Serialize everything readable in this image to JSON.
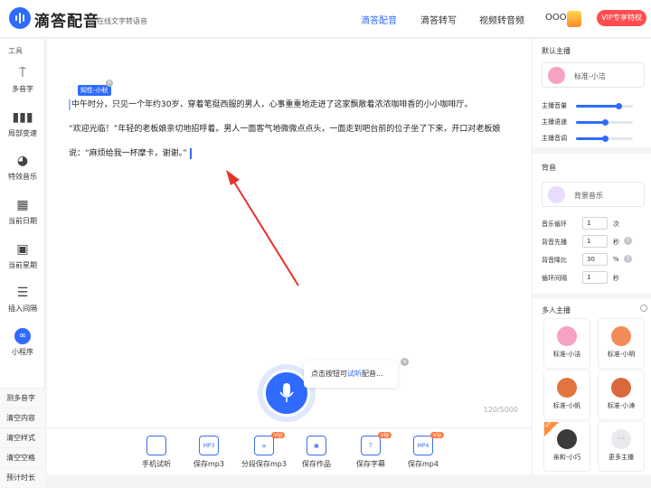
{
  "header": {
    "app_title": "滴答配音",
    "app_subtitle": "在线文字转语音",
    "nav": [
      {
        "label": "滴答配音",
        "active": true
      },
      {
        "label": "滴答转写",
        "active": false
      },
      {
        "label": "视频转音频",
        "active": false
      }
    ],
    "user_name": "OOO",
    "vip_button": "VIP专享特权"
  },
  "sidebar": {
    "title": "工具",
    "tools": [
      {
        "label": "多音字",
        "icon": "polyphone-icon"
      },
      {
        "label": "局部变速",
        "icon": "speed-icon"
      },
      {
        "label": "特效音乐",
        "icon": "music-disc-icon"
      },
      {
        "label": "当前日期",
        "icon": "calendar-icon"
      },
      {
        "label": "当前星期",
        "icon": "calendar-week-icon"
      },
      {
        "label": "插入间隔",
        "icon": "interval-icon"
      },
      {
        "label": "小程序",
        "icon": "mini-program-icon"
      }
    ],
    "links": [
      "测多音字",
      "清空内容",
      "清空样式",
      "清空空格",
      "预计时长"
    ]
  },
  "editor": {
    "voice_tag": "知性-小秋",
    "paragraph1": "中午时分，只见一个年约30岁，穿着笔挺西服的男人，心事重重地走进了这家飘散着浓浓咖啡香的小小咖啡厅。",
    "paragraph2": "“欢迎光临！”年轻的老板娘亲切地招呼着。男人一面客气地微微点点头，一面走到吧台前的位子坐了下来，开口对老板娘说：“麻烦给我一杯摩卡，谢谢。”",
    "char_count": "120/5000",
    "tip_prefix": "点击按钮可",
    "tip_highlight": "试听",
    "tip_suffix": "配音..."
  },
  "bottom_actions": [
    {
      "label": "手机试听",
      "icon": "phone-icon",
      "icon_text": "",
      "vip": false
    },
    {
      "label": "保存mp3",
      "icon": "mp3-file-icon",
      "icon_text": "MP3",
      "vip": false
    },
    {
      "label": "分段保存mp3",
      "icon": "list-icon",
      "icon_text": "≡",
      "vip": true
    },
    {
      "label": "保存作品",
      "icon": "save-icon",
      "icon_text": "▣",
      "vip": false
    },
    {
      "label": "保存字幕",
      "icon": "subtitle-icon",
      "icon_text": "T",
      "vip": true
    },
    {
      "label": "保存mp4",
      "icon": "mp4-file-icon",
      "icon_text": "MP4",
      "vip": true
    }
  ],
  "vip_badge": "vip",
  "right_panel": {
    "default_anchor_title": "默认主播",
    "default_anchor_name": "标准-小洁",
    "sliders": [
      {
        "label": "主播音量",
        "value": "7",
        "level": 0.75
      },
      {
        "label": "主播语速",
        "value": "5",
        "level": 0.5
      },
      {
        "label": "主播音调",
        "value": "5",
        "level": 0.5
      }
    ],
    "bgm_title": "背音",
    "bgm_name": "背景音乐",
    "bgm_settings": [
      {
        "label": "音乐循环",
        "value": "1",
        "unit": "次",
        "help": false
      },
      {
        "label": "背音先播",
        "value": "1",
        "unit": "秒",
        "help": true
      },
      {
        "label": "背音降比",
        "value": "30",
        "unit": "%",
        "help": true
      },
      {
        "label": "循环间隔",
        "value": "1",
        "unit": "秒",
        "help": false
      }
    ],
    "multi_title": "多人主播",
    "multi_anchors": [
      {
        "name": "标准-小洁",
        "color": "#f7a1c4",
        "vip": false
      },
      {
        "name": "标准-小明",
        "color": "#f28b5a",
        "vip": false
      },
      {
        "name": "标准-小帆",
        "color": "#e2753f",
        "vip": false
      },
      {
        "name": "标准-小涛",
        "color": "#d9693c",
        "vip": false
      },
      {
        "name": "亲和-小巧",
        "color": "#3a3a3a",
        "vip": true
      },
      {
        "name": "更多主播",
        "color": "#e8eaee",
        "vip": false
      }
    ],
    "more_icon_text": "···",
    "vip_corner_text": "VIP"
  }
}
